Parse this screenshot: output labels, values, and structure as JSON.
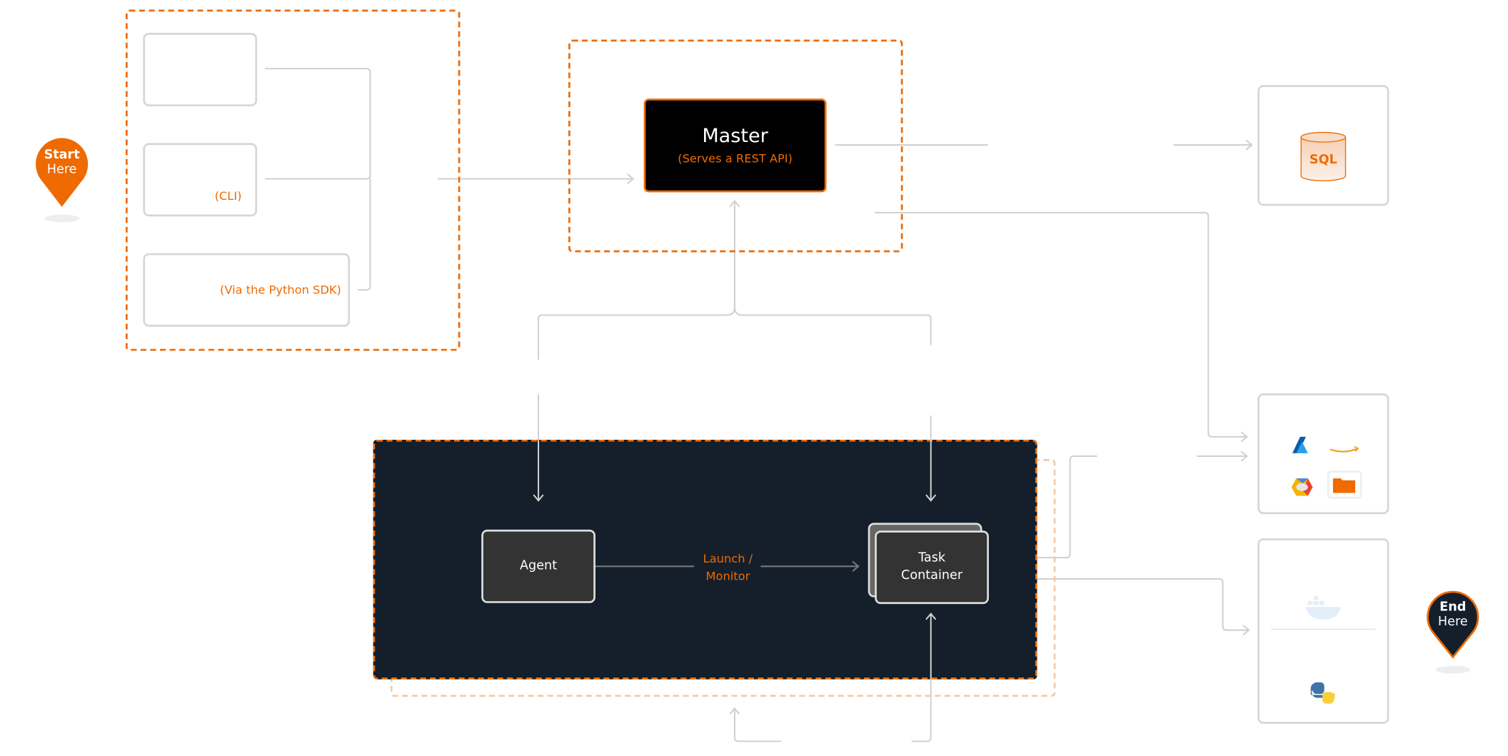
{
  "start_pin": {
    "line1": "Start",
    "line2": "Here",
    "color": "#ef6a00"
  },
  "end_pin": {
    "line1": "End",
    "line2": "Here",
    "color": "#141f2b"
  },
  "clients": {
    "cli_label": "(CLI)",
    "sdk_label": "(Via the Python SDK)"
  },
  "master": {
    "title": "Master",
    "subtitle": "(Serves a REST API)"
  },
  "agent": {
    "label": "Agent"
  },
  "edge_label": {
    "line1": "Launch /",
    "line2": "Monitor"
  },
  "task_container": {
    "line1": "Task",
    "line2": "Container"
  },
  "database": {
    "label": "SQL",
    "icon": "database-cylinder-icon"
  },
  "storage": {
    "icons": [
      "azure-icon",
      "amazon-icon",
      "google-cloud-icon",
      "folder-icon"
    ]
  },
  "environment": {
    "icons": [
      "docker-icon",
      "python-icon"
    ]
  },
  "colors": {
    "accent": "#ef6a00",
    "dark": "#141f2b",
    "line": "#d0d0d0"
  }
}
